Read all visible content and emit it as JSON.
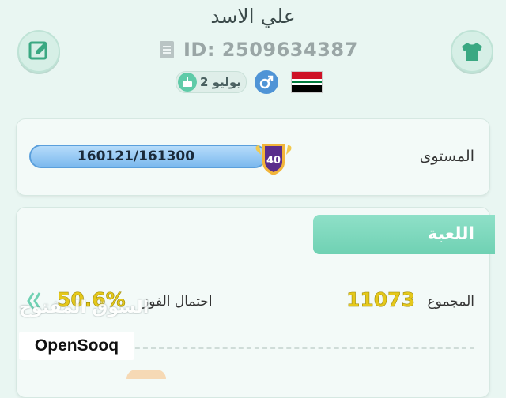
{
  "profile": {
    "name": "علي الاسد",
    "id_label": "ID: 2509634387",
    "birthday": "2 يوليو",
    "gender": "male"
  },
  "level": {
    "label": "المستوى",
    "progress_text": "160121/161300",
    "progress_fraction": 0.9927,
    "level_number": "40"
  },
  "game": {
    "title": "اللعبة",
    "total_label": "المجموع",
    "total_value": "11073",
    "win_label": "احتمال الفوز",
    "win_value": "50.6%"
  },
  "watermark": {
    "arabic": "السوق المفتوح",
    "brand": "OpenSooq"
  },
  "colors": {
    "background": "#e9f6f2",
    "accent": "#6fd1b3",
    "progress": "#8fc2ec",
    "stat_yellow": "#e5c81b"
  }
}
